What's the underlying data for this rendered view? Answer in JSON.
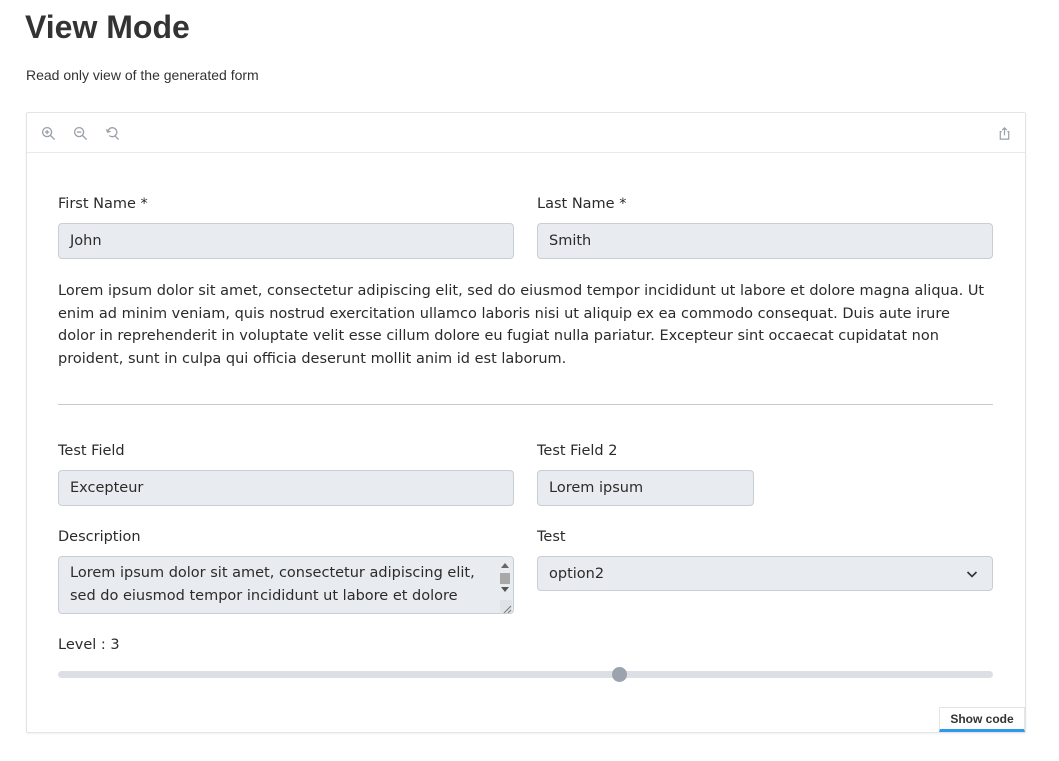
{
  "page": {
    "title": "View Mode",
    "subtitle": "Read only view of the generated form"
  },
  "toolbar": {
    "icons": [
      "zoom-in-icon",
      "zoom-out-icon",
      "reset-zoom-icon",
      "share-icon"
    ]
  },
  "form": {
    "first_name": {
      "label": "First Name *",
      "value": "John"
    },
    "last_name": {
      "label": "Last Name *",
      "value": "Smith"
    },
    "paragraph": "Lorem ipsum dolor sit amet, consectetur adipiscing elit, sed do eiusmod tempor incididunt ut labore et dolore magna aliqua. Ut enim ad minim veniam, quis nostrud exercitation ullamco laboris nisi ut aliquip ex ea commodo consequat. Duis aute irure dolor in reprehenderit in voluptate velit esse cillum dolore eu fugiat nulla pariatur. Excepteur sint occaecat cupidatat non proident, sunt in culpa qui officia deserunt mollit anim id est laborum.",
    "test_field": {
      "label": "Test Field",
      "value": "Excepteur"
    },
    "test_field_2": {
      "label": "Test Field 2",
      "value": "Lorem ipsum"
    },
    "description": {
      "label": "Description",
      "value": "Lorem ipsum dolor sit amet, consectetur adipiscing elit, sed do eiusmod tempor incididunt ut labore et dolore"
    },
    "test_select": {
      "label": "Test",
      "value": "option2"
    },
    "level": {
      "label": "Level : 3",
      "value": 3,
      "min": 0,
      "max": 5
    }
  },
  "footer": {
    "show_code_label": "Show code"
  },
  "colors": {
    "field_bg": "#e8ebef",
    "field_border": "#c9ced5",
    "accent": "#2e9bea",
    "slider_thumb": "#9ba3ae"
  }
}
